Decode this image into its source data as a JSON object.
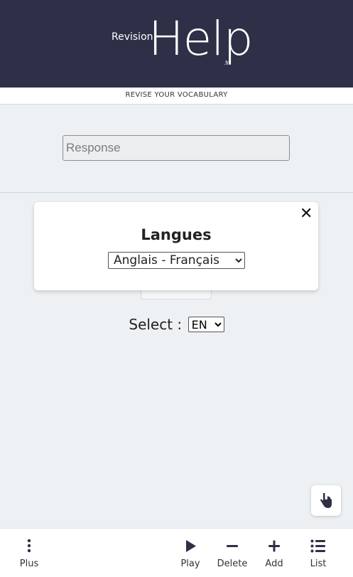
{
  "header": {
    "logo_small": "Revision",
    "logo_big": "Help",
    "logo_suffix": ".fr",
    "subtitle": "REVISE YOUR VOCABULARY"
  },
  "response": {
    "placeholder": "Response",
    "value": ""
  },
  "modal": {
    "title": "Langues",
    "close_icon": "close-icon",
    "selected_option": "Anglais - Français"
  },
  "select_row": {
    "label": "Select :",
    "selected": "EN"
  },
  "floating": {
    "icon": "hand-pointer-icon"
  },
  "bottom_nav": {
    "items": [
      {
        "label": "Plus",
        "icon": "more-vertical-icon"
      },
      {
        "label": "Play",
        "icon": "play-icon"
      },
      {
        "label": "Delete",
        "icon": "minus-icon"
      },
      {
        "label": "Add",
        "icon": "plus-icon"
      },
      {
        "label": "List",
        "icon": "list-icon"
      }
    ]
  },
  "colors": {
    "header_bg": "#2e3047",
    "page_bg": "#eef1f4",
    "icon_color": "#2e3047"
  }
}
